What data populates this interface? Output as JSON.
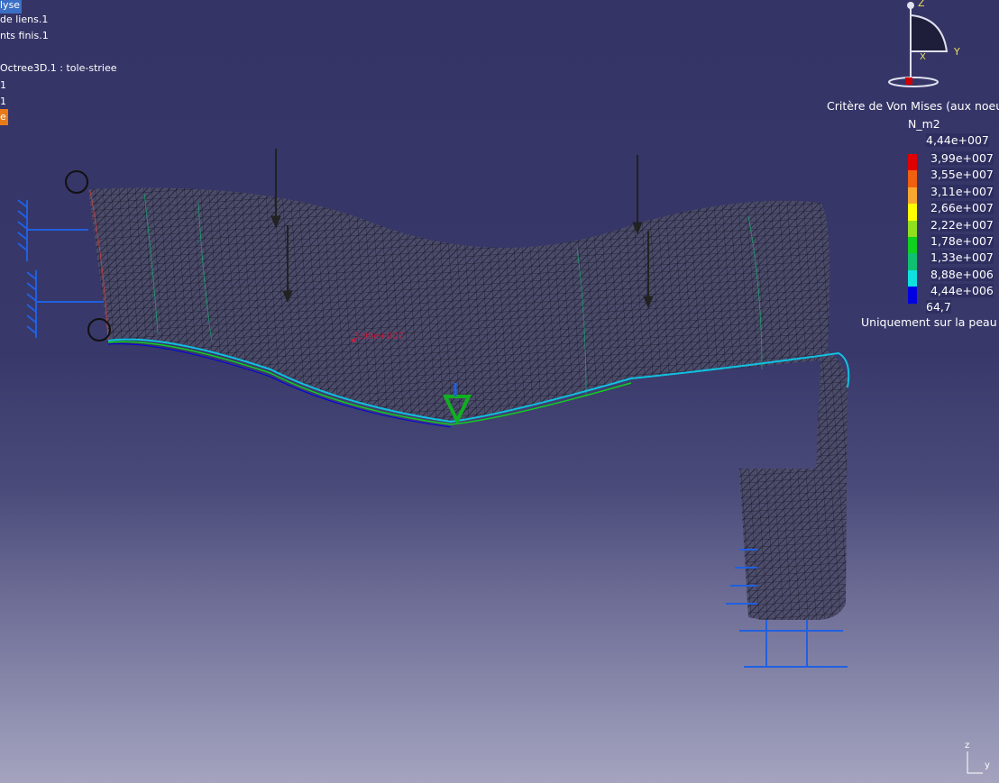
{
  "tree": {
    "items": [
      {
        "label": "lyse",
        "state": "selected-blue"
      },
      {
        "label": "de liens.1"
      },
      {
        "label": "nts finis.1"
      },
      {
        "label": "Octree3D.1 : tole-striee"
      },
      {
        "label": "1"
      },
      {
        "label": "1"
      },
      {
        "label": "e",
        "state": "selected-orange"
      }
    ]
  },
  "compass": {
    "z": "Z",
    "y": "Y",
    "x": "X"
  },
  "legend": {
    "title": "Critère de Von Mises (aux noeuds",
    "unit": "N_m2",
    "max": "4,44e+007",
    "levels": [
      {
        "label": "3,99e+007",
        "color": "#e00000"
      },
      {
        "label": "3,55e+007",
        "color": "#f06010"
      },
      {
        "label": "3,11e+007",
        "color": "#f8a830"
      },
      {
        "label": "2,66e+007",
        "color": "#ffff00"
      },
      {
        "label": "2,22e+007",
        "color": "#90e020"
      },
      {
        "label": "1,78e+007",
        "color": "#10d020"
      },
      {
        "label": "1,33e+007",
        "color": "#10c070"
      },
      {
        "label": "8,88e+006",
        "color": "#10e0e0"
      },
      {
        "label": "4,44e+006",
        "color": "#0000e0"
      }
    ],
    "min": "64,7",
    "note": "Uniquement sur la peau"
  },
  "probe_label": "3,99e+007",
  "axis": {
    "z": "z",
    "y": "y"
  }
}
